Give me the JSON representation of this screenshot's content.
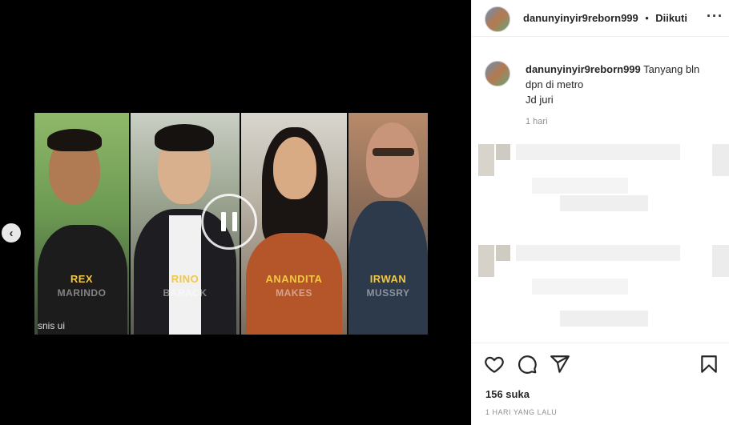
{
  "video": {
    "people": [
      {
        "name": "REX",
        "sub": "MARINDO"
      },
      {
        "name": "RINO",
        "sub": "BARACK"
      },
      {
        "name": "ANANDITA",
        "sub": "MAKES"
      },
      {
        "name": "IRWAN",
        "sub": "MUSSRY"
      }
    ],
    "watermark": "snis ui"
  },
  "header": {
    "username": "danunyinyir9reborn999",
    "separator": "•",
    "follow_status": "Diikuti",
    "more_icon": "more-dots-icon"
  },
  "caption": {
    "username": "danunyinyir9reborn999",
    "text_line1": "Tanyang bln dpn di metro",
    "text_line2": "Jd juri",
    "time": "1 hari"
  },
  "actions": {
    "icons": [
      "heart-icon",
      "comment-icon",
      "share-icon",
      "bookmark-icon"
    ],
    "likes": "156 suka",
    "posted": "1 HARI YANG LALU"
  },
  "colors": {
    "name_gold": "#f2c744",
    "text": "#262626",
    "muted": "#8e8e8e"
  }
}
